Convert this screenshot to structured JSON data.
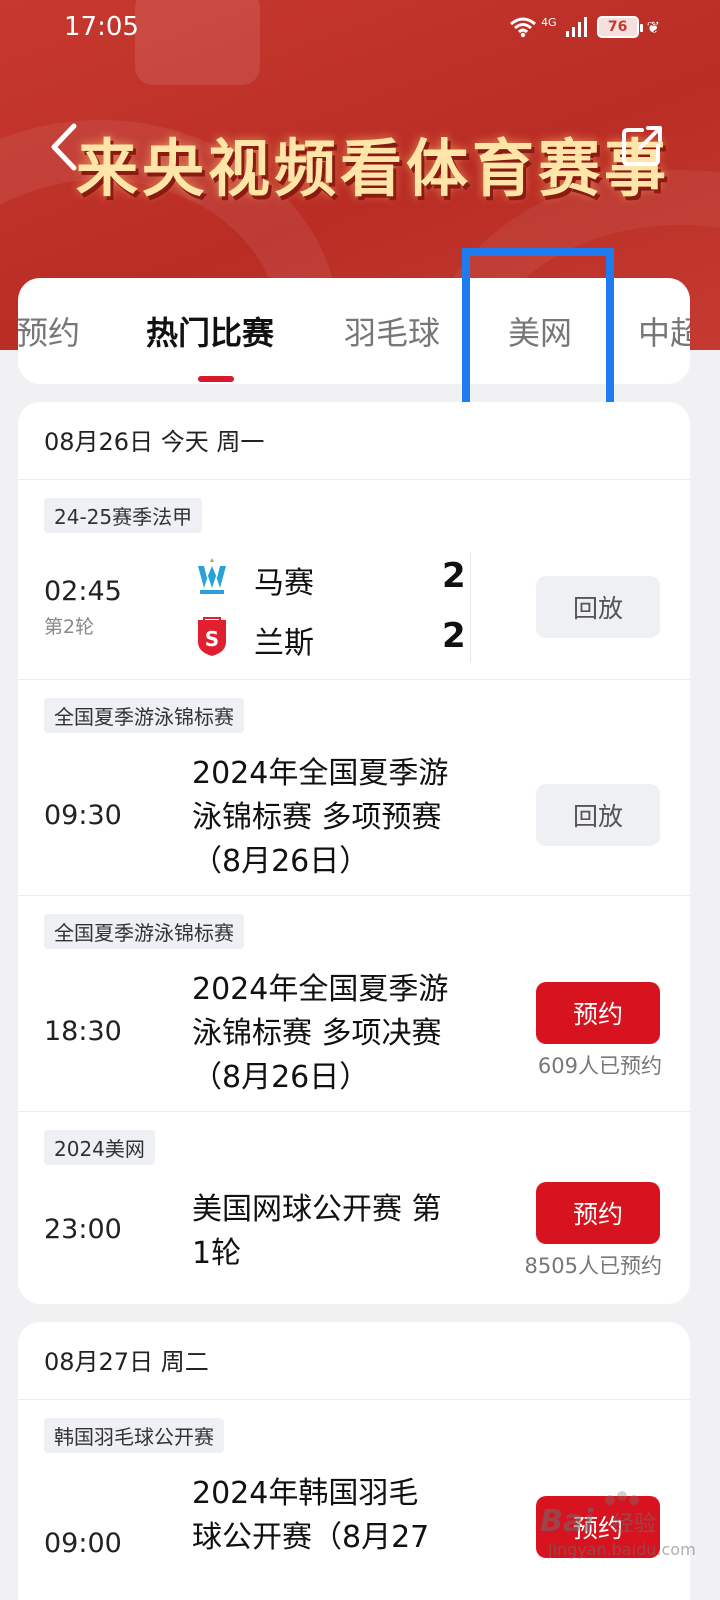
{
  "status_bar": {
    "time": "17:05",
    "network": "4G",
    "battery": "76"
  },
  "header": {
    "banner_title": "来央视频看体育赛事"
  },
  "tabs": [
    {
      "label": "预约",
      "active": false
    },
    {
      "label": "热门比赛",
      "active": true
    },
    {
      "label": "羽毛球",
      "active": false
    },
    {
      "label": "美网",
      "active": false,
      "highlighted": true
    },
    {
      "label": "中超",
      "active": false
    }
  ],
  "day1": {
    "date": "08月26日 今天 周一",
    "events": [
      {
        "tag": "24-25赛季法甲",
        "time": "02:45",
        "round": "第2轮",
        "home": {
          "name": "马赛",
          "score": "2"
        },
        "away": {
          "name": "兰斯",
          "score": "2"
        },
        "button": "回放"
      },
      {
        "tag": "全国夏季游泳锦标赛",
        "time": "09:30",
        "title_lines": [
          "2024年全国夏季游",
          "泳锦标赛 多项预赛",
          "（8月26日）"
        ],
        "button": "回放"
      },
      {
        "tag": "全国夏季游泳锦标赛",
        "time": "18:30",
        "title_lines": [
          "2024年全国夏季游",
          "泳锦标赛 多项决赛",
          "（8月26日）"
        ],
        "button": "预约",
        "count": "609人已预约"
      },
      {
        "tag": "2024美网",
        "time": "23:00",
        "title_lines": [
          "美国网球公开赛 第",
          "1轮"
        ],
        "button": "预约",
        "count": "8505人已预约"
      }
    ]
  },
  "day2": {
    "date": "08月27日 周二",
    "events": [
      {
        "tag": "韩国羽毛球公开赛",
        "time": "09:00",
        "title_lines": [
          "2024年韩国羽毛",
          "球公开赛（8月27"
        ],
        "button": "预约"
      }
    ]
  },
  "watermark": {
    "brand": "Bai",
    "cn": "经验",
    "url": "jingyan.baidu.com"
  },
  "colors": {
    "header_red": "#c7392f",
    "accent_red": "#d6131f",
    "highlight_blue": "#1e7bf0"
  }
}
